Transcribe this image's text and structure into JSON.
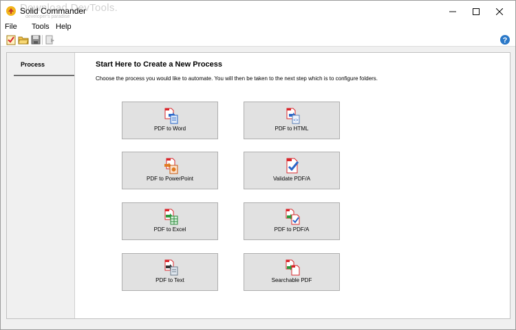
{
  "window": {
    "title": "Solid Commander",
    "watermark": "Download DevTools.",
    "watermark_sub": "developer's paradise"
  },
  "menu": {
    "items": [
      "File",
      "Tools",
      "Help"
    ]
  },
  "toolbar": {
    "icons": [
      "checklist-icon",
      "open-folder-icon",
      "save-icon",
      "run-icon"
    ],
    "help_icon": "help-icon"
  },
  "sidebar": {
    "items": [
      {
        "label": "Process"
      }
    ]
  },
  "main": {
    "heading": "Start Here to Create a New Process",
    "description": "Choose the process you would like to automate. You will then be taken to the next step which is to configure folders.",
    "processes": [
      {
        "label": "PDF to Word",
        "icon": "pdf-to-word-icon"
      },
      {
        "label": "PDF to HTML",
        "icon": "pdf-to-html-icon"
      },
      {
        "label": "PDF to PowerPoint",
        "icon": "pdf-to-powerpoint-icon"
      },
      {
        "label": "Validate PDF/A",
        "icon": "validate-pdfa-icon"
      },
      {
        "label": "PDF to Excel",
        "icon": "pdf-to-excel-icon"
      },
      {
        "label": "PDF to PDF/A",
        "icon": "pdf-to-pdfa-icon"
      },
      {
        "label": "PDF to Text",
        "icon": "pdf-to-text-icon"
      },
      {
        "label": "Searchable PDF",
        "icon": "searchable-pdf-icon"
      }
    ]
  },
  "colors": {
    "accent_red": "#d9252a",
    "help_blue": "#2a78c8",
    "button_bg": "#e1e1e1",
    "button_border": "#adadad"
  }
}
